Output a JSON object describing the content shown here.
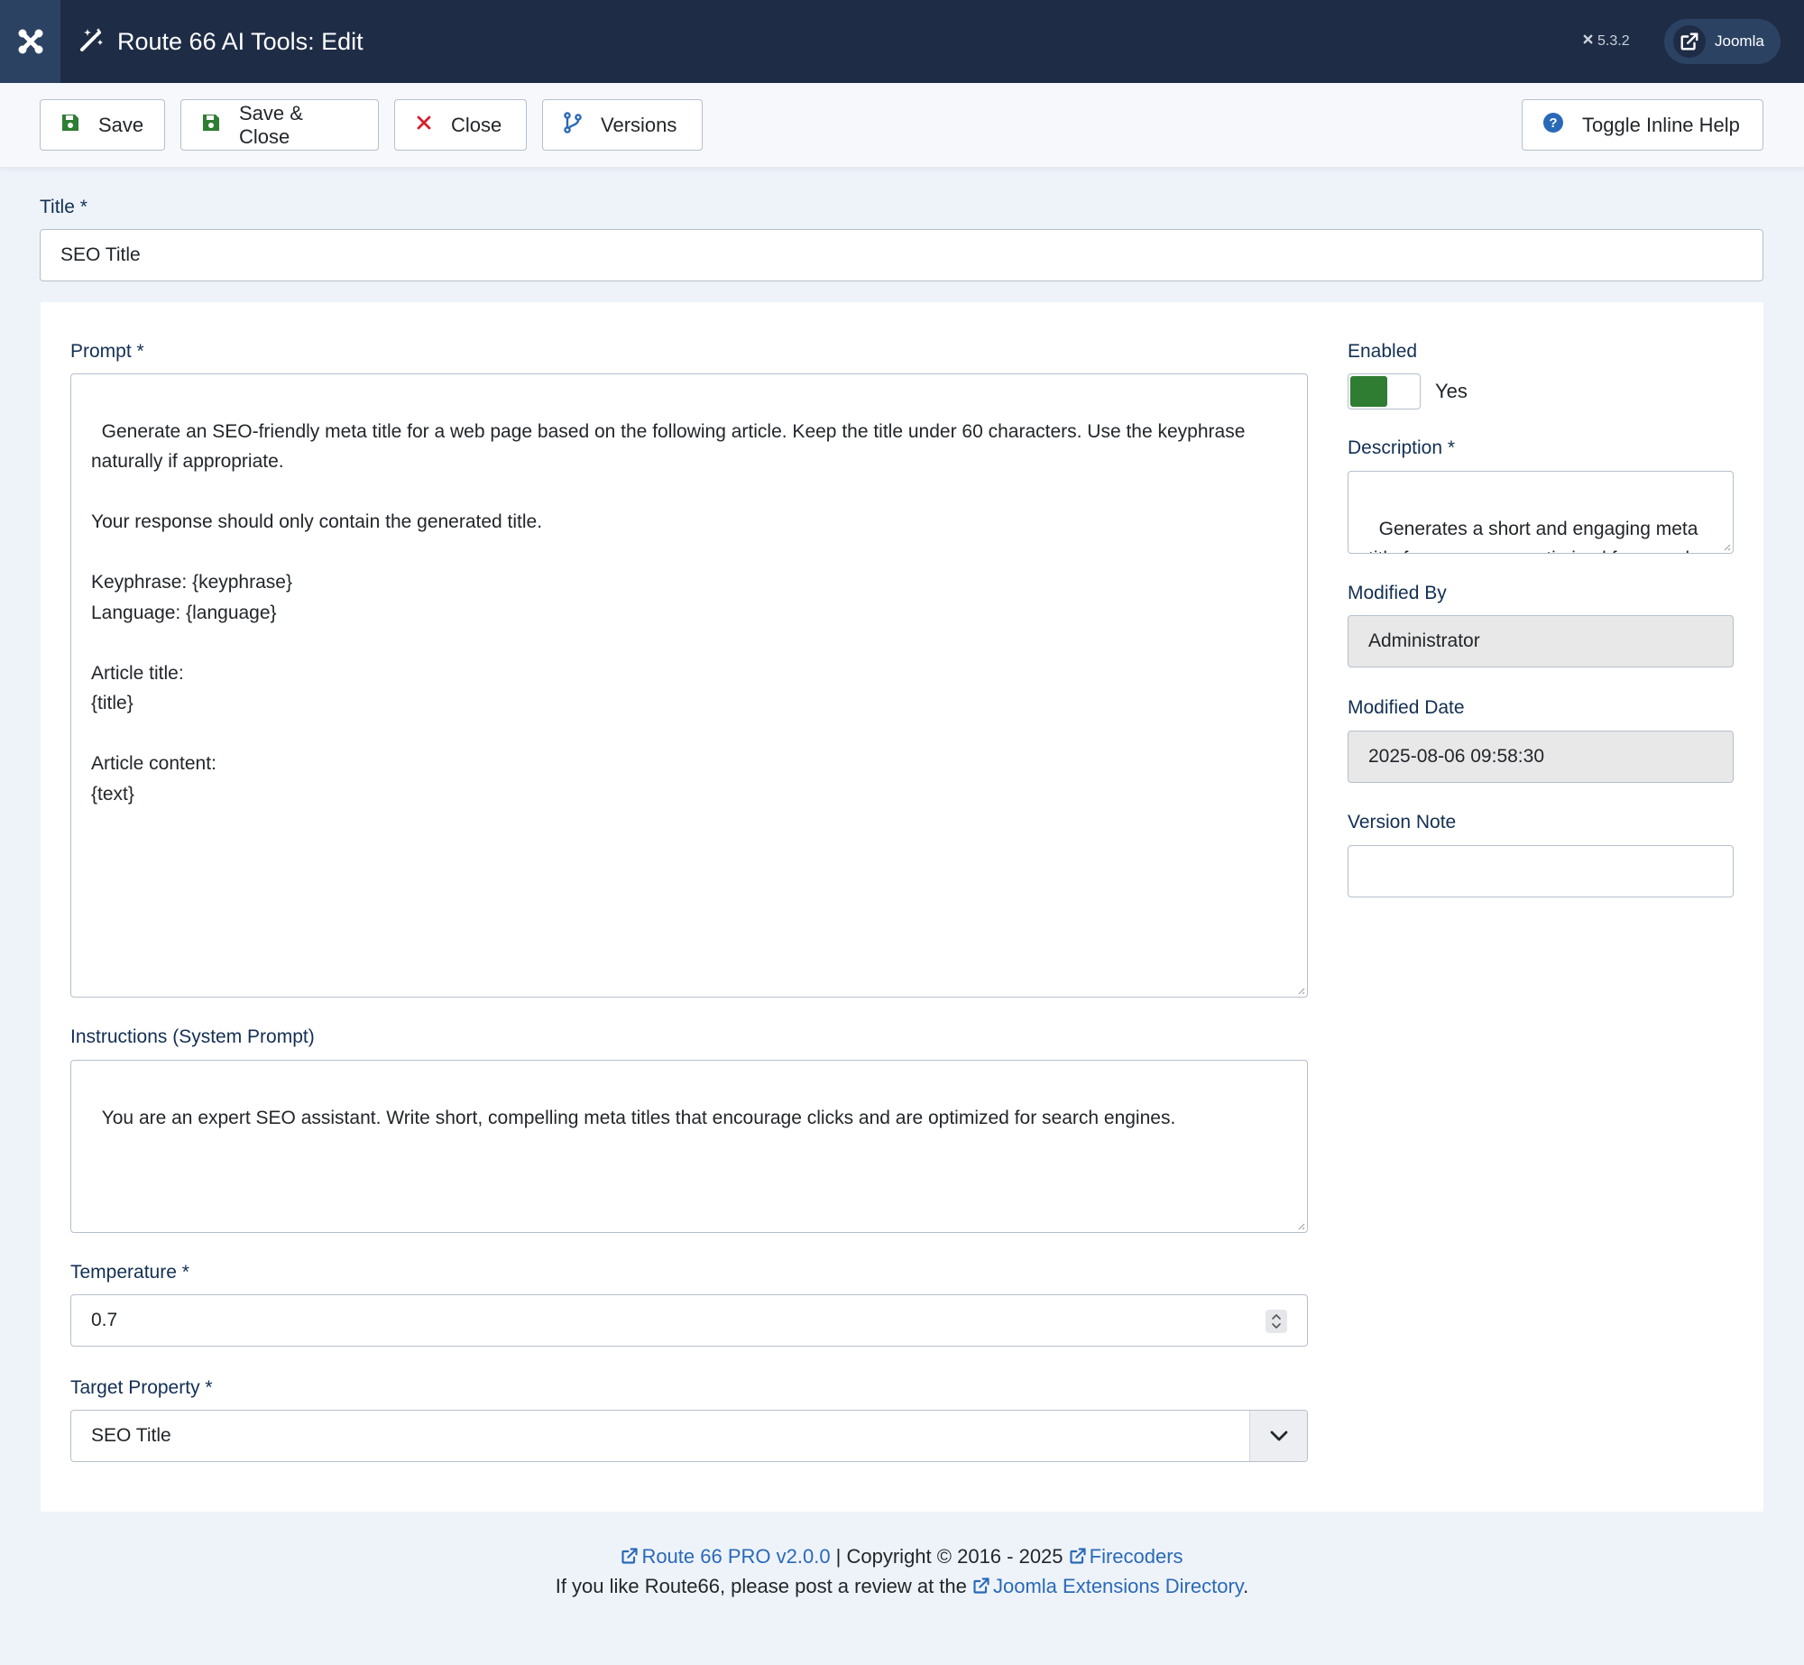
{
  "header": {
    "title": "Route 66 AI Tools: Edit",
    "version": "5.3.2",
    "joomla_button": "Joomla"
  },
  "toolbar": {
    "save": "Save",
    "save_close": "Save & Close",
    "close": "Close",
    "versions": "Versions",
    "toggle_help": "Toggle Inline Help"
  },
  "form": {
    "title_label": "Title *",
    "title_value": "SEO Title",
    "prompt_label": "Prompt *",
    "prompt_value": "Generate an SEO-friendly meta title for a web page based on the following article. Keep the title under 60 characters. Use the keyphrase naturally if appropriate.\n\nYour response should only contain the generated title.\n\nKeyphrase: {keyphrase}\nLanguage: {language}\n\nArticle title:\n{title}\n\nArticle content:\n{text}",
    "instructions_label": "Instructions (System Prompt)",
    "instructions_value": "You are an expert SEO assistant. Write short, compelling meta titles that encourage clicks and are optimized for search engines.",
    "temperature_label": "Temperature *",
    "temperature_value": "0.7",
    "target_label": "Target Property *",
    "target_value": "SEO Title",
    "enabled_label": "Enabled",
    "enabled_value": "Yes",
    "description_label": "Description *",
    "description_value": "Generates a short and engaging meta title for your page, optimized for search engine visibility and click-through rate.",
    "modified_by_label": "Modified By",
    "modified_by_value": "Administrator",
    "modified_date_label": "Modified Date",
    "modified_date_value": "2025-08-06 09:58:30",
    "version_note_label": "Version Note",
    "version_note_value": ""
  },
  "footer": {
    "product_link": "Route 66 PRO v2.0.0",
    "copyright": " | Copyright © 2016 - 2025 ",
    "company_link": "Firecoders",
    "review_text": "If you like Route66, please post a review at the ",
    "directory_link": "Joomla Extensions Directory",
    "period": "."
  },
  "colors": {
    "header_bg": "#1e2c46",
    "accent_green": "#2f7d32",
    "link_blue": "#2a69b8",
    "close_red": "#d6202e",
    "label_navy": "#132f53"
  },
  "icons": [
    "joomla-logo-icon",
    "magic-wand-icon",
    "external-link-icon",
    "save-icon",
    "close-icon",
    "branch-icon",
    "help-icon",
    "chevron-down-icon",
    "spinner-arrows-icon"
  ]
}
